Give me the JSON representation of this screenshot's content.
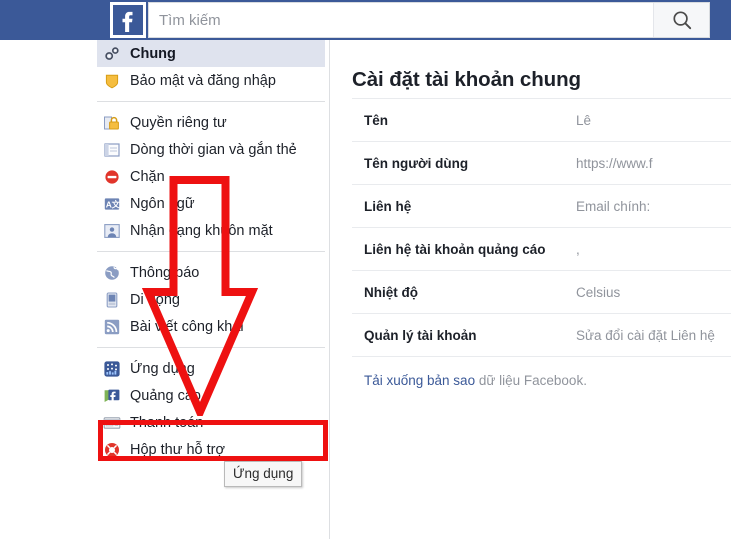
{
  "topbar": {
    "logo_icon": "facebook-f-logo",
    "search": {
      "placeholder": "Tìm kiếm",
      "value": "",
      "button_icon": "search-icon"
    },
    "brand_color": "#3b5998"
  },
  "sidebar": {
    "groups": [
      {
        "items": [
          {
            "label": "Chung",
            "icon": "gears-icon",
            "selected": true
          },
          {
            "label": "Bảo mật và đăng nhập",
            "icon": "shield-icon",
            "selected": false
          }
        ]
      },
      {
        "items": [
          {
            "label": "Quyền riêng tư",
            "icon": "padlock-icon",
            "selected": false
          },
          {
            "label": "Dòng thời gian và gắn thẻ",
            "icon": "timeline-icon",
            "selected": false
          },
          {
            "label": "Chặn",
            "icon": "block-icon",
            "selected": false
          },
          {
            "label": "Ngôn ngữ",
            "icon": "language-icon",
            "selected": false
          },
          {
            "label": "Nhận dạng khuôn mặt",
            "icon": "face-recognition-icon",
            "selected": false
          }
        ]
      },
      {
        "items": [
          {
            "label": "Thông báo",
            "icon": "globe-icon",
            "selected": false
          },
          {
            "label": "Di động",
            "icon": "mobile-phone-icon",
            "selected": false
          },
          {
            "label": "Bài viết công khai",
            "icon": "rss-feed-icon",
            "selected": false
          }
        ]
      },
      {
        "items": [
          {
            "label": "Ứng dụng",
            "icon": "apps-icon",
            "selected": false
          },
          {
            "label": "Quảng cáo",
            "icon": "ads-icon",
            "selected": false
          },
          {
            "label": "Thanh toán",
            "icon": "credit-card-icon",
            "selected": false
          },
          {
            "label": "Hộp thư hỗ trợ",
            "icon": "lifebuoy-icon",
            "selected": false
          }
        ]
      }
    ]
  },
  "content": {
    "title": "Cài đặt tài khoản chung",
    "rows": [
      {
        "label": "Tên",
        "value": "Lê"
      },
      {
        "label": "Tên người dùng",
        "value": "https://www.f"
      },
      {
        "label": "Liên hệ",
        "value": "Email chính:"
      },
      {
        "label": "Liên hệ tài khoản quảng cáo",
        "value": ","
      },
      {
        "label": "Nhiệt độ",
        "value": "Celsius"
      },
      {
        "label": "Quản lý tài khoản",
        "value": "Sửa đổi cài đặt Liên hệ"
      }
    ],
    "download_link_text": "Tải xuống bản sao",
    "download_rest_text": " dữ liệu Facebook."
  },
  "tooltip": {
    "text": "Ứng dụng"
  },
  "annotations": {
    "arrow_color": "#ee1111",
    "box_color": "#ee1111",
    "arrow_target": "Ứng dụng",
    "box_target": "Ứng dụng"
  }
}
